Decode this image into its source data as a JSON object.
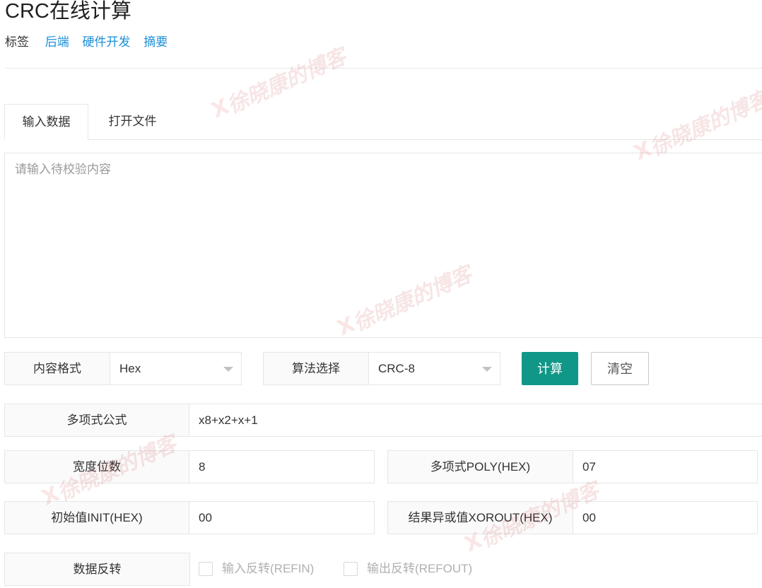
{
  "page": {
    "title": "CRC在线计算",
    "tags_label": "标签",
    "tags": [
      "后端",
      "硬件开发",
      "摘要"
    ]
  },
  "tabs": [
    {
      "label": "输入数据",
      "active": true
    },
    {
      "label": "打开文件",
      "active": false
    }
  ],
  "input": {
    "placeholder": "请输入待校验内容",
    "value": ""
  },
  "format": {
    "label": "内容格式",
    "selected": "Hex"
  },
  "algorithm": {
    "label": "算法选择",
    "selected": "CRC-8"
  },
  "buttons": {
    "calculate": "计算",
    "clear": "清空"
  },
  "params": {
    "formula_label": "多项式公式",
    "formula_value": "x8+x2+x+1",
    "width_label": "宽度位数",
    "width_value": "8",
    "poly_label": "多项式POLY(HEX)",
    "poly_value": "07",
    "init_label": "初始值INIT(HEX)",
    "init_value": "00",
    "xorout_label": "结果异或值XOROUT(HEX)",
    "xorout_value": "00",
    "reverse_label": "数据反转",
    "refin_label": "输入反转(REFIN)",
    "refout_label": "输出反转(REFOUT)",
    "refin_checked": false,
    "refout_checked": false
  },
  "watermark": {
    "text": "徐晓康的博客",
    "mark": "X"
  },
  "colors": {
    "accent": "#119787",
    "link": "#1a8fd6",
    "watermark": "#c23030"
  }
}
